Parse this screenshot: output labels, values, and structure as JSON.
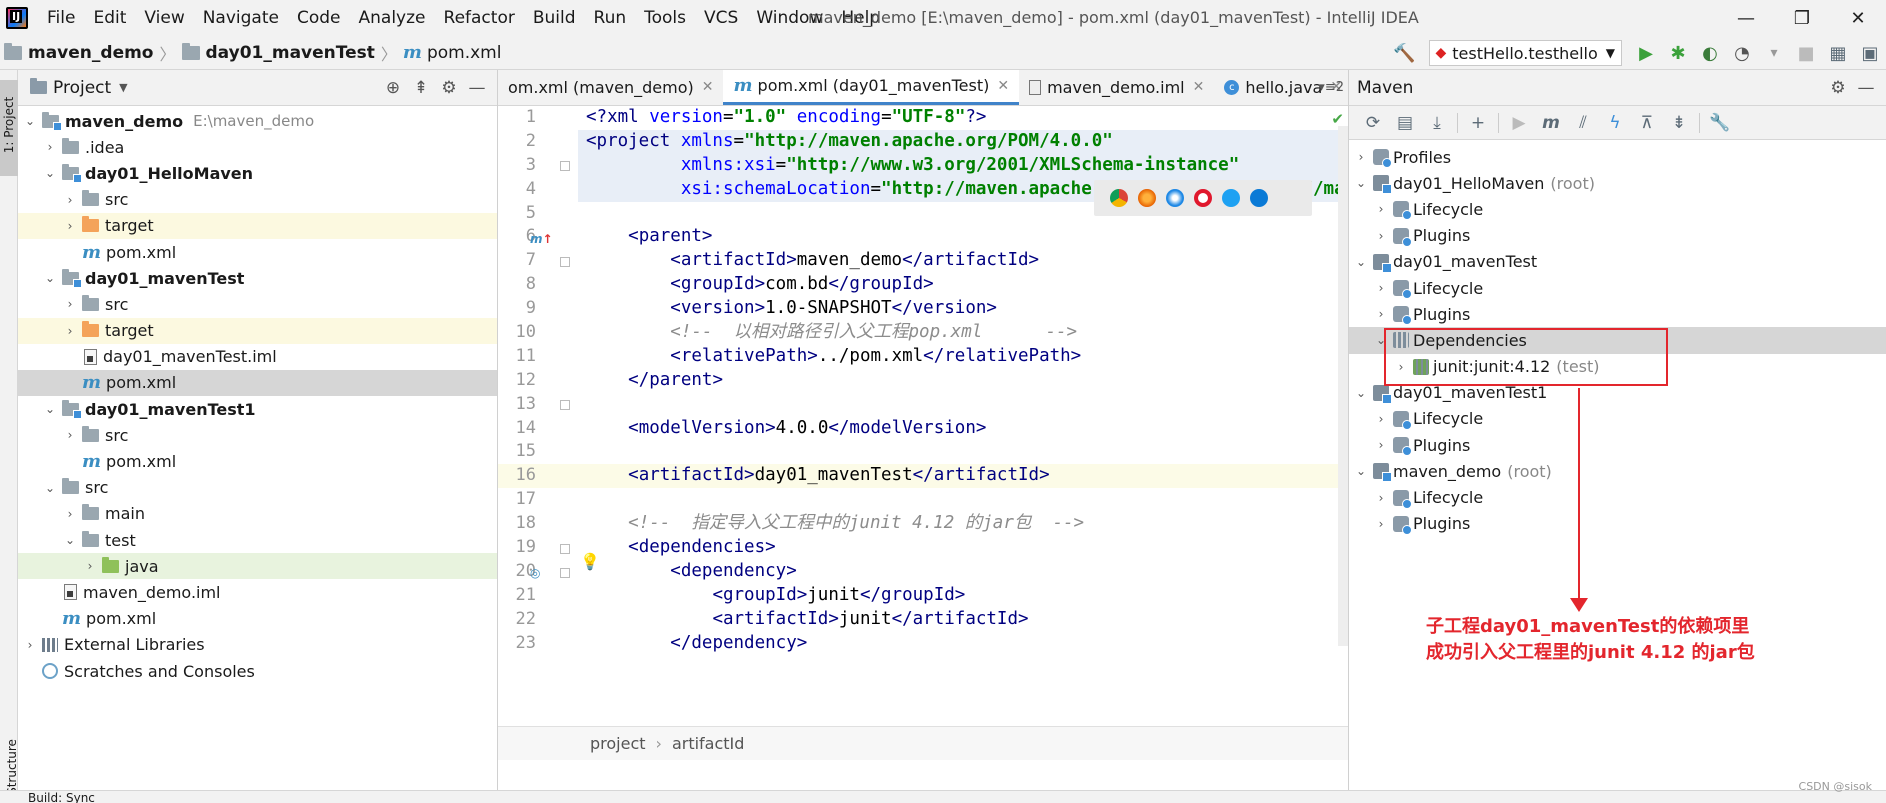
{
  "menubar": {
    "items": [
      "File",
      "Edit",
      "View",
      "Navigate",
      "Code",
      "Analyze",
      "Refactor",
      "Build",
      "Run",
      "Tools",
      "VCS",
      "Window",
      "Help"
    ],
    "window_title": "maven_demo [E:\\maven_demo] - pom.xml (day01_mavenTest) - IntelliJ IDEA"
  },
  "navbar": {
    "crumbs": [
      "maven_demo",
      "day01_mavenTest",
      "pom.xml"
    ],
    "run_config": "testHello.testhello"
  },
  "left_stripe": {
    "top_tab": "1: Project",
    "bottom_tab": "Structure"
  },
  "project_panel": {
    "title": "Project",
    "root_name": "maven_demo",
    "root_path": "E:\\maven_demo",
    "nodes": [
      ".idea",
      "day01_HelloMaven",
      "src",
      "target",
      "pom.xml",
      "day01_mavenTest",
      "src",
      "target",
      "day01_mavenTest.iml",
      "pom.xml",
      "day01_mavenTest1",
      "src",
      "pom.xml",
      "src",
      "main",
      "test",
      "java",
      "maven_demo.iml",
      "pom.xml",
      "External Libraries",
      "Scratches and Consoles"
    ]
  },
  "editor": {
    "tabs": [
      "om.xml (maven_demo)",
      "pom.xml (day01_mavenTest)",
      "maven_demo.iml",
      "hello.java"
    ],
    "tab_overflow": "2",
    "line_numbers": [
      "1",
      "2",
      "3",
      "4",
      "5",
      "6",
      "7",
      "8",
      "9",
      "10",
      "11",
      "12",
      "13",
      "14",
      "15",
      "16",
      "17",
      "18",
      "19",
      "20",
      "21",
      "22",
      "23"
    ],
    "breadcrumb": [
      "project",
      "artifactId"
    ]
  },
  "maven": {
    "title": "Maven",
    "rows": [
      {
        "label": "Profiles"
      },
      {
        "label": "day01_HelloMaven",
        "suffix": "(root)"
      },
      {
        "label": "Lifecycle"
      },
      {
        "label": "Plugins"
      },
      {
        "label": "day01_mavenTest"
      },
      {
        "label": "Lifecycle"
      },
      {
        "label": "Plugins"
      },
      {
        "label": "Dependencies"
      },
      {
        "label": "junit:junit:4.12",
        "suffix": "(test)"
      },
      {
        "label": "day01_mavenTest1"
      },
      {
        "label": "Lifecycle"
      },
      {
        "label": "Plugins"
      },
      {
        "label": "maven_demo",
        "suffix": "(root)"
      },
      {
        "label": "Lifecycle"
      },
      {
        "label": "Plugins"
      }
    ]
  },
  "annotation": {
    "line1": "子工程day01_mavenTest的依赖项里",
    "line2": "成功引入父工程里的junit 4.12 的jar包"
  },
  "watermark": "CSDN @sisok",
  "bottom_strip": "Build: Sync"
}
